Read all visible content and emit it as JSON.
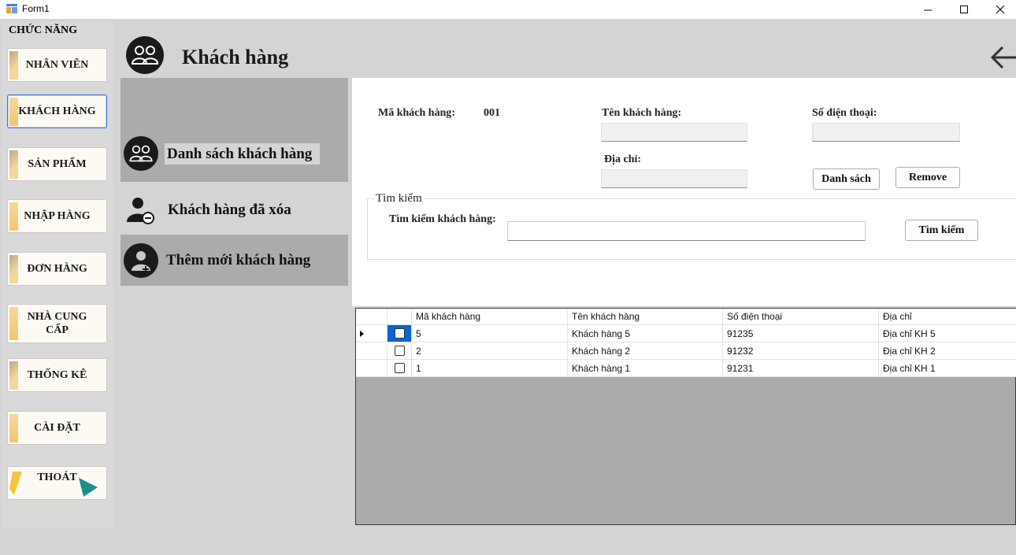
{
  "window": {
    "title": "Form1",
    "minimize_glyph": "—",
    "maximize_glyph": "☐",
    "close_glyph": "✕"
  },
  "sidebar": {
    "title": "CHỨC NĂNG",
    "items": [
      {
        "label": "NHÂN VIÊN"
      },
      {
        "label": "KHÁCH HÀNG"
      },
      {
        "label": "SẢN PHẨM"
      },
      {
        "label": "NHẬP HÀNG"
      },
      {
        "label": "ĐƠN HÀNG"
      },
      {
        "label": "NHÀ CUNG CẤP"
      },
      {
        "label": "THỐNG KÊ"
      },
      {
        "label": "CÀI ĐẶT"
      },
      {
        "label": "THOÁT"
      }
    ]
  },
  "header": {
    "title": "Khách hàng",
    "icon": "users-icon",
    "back_icon": "arrow-left-icon"
  },
  "submenu": {
    "items": [
      {
        "label": "Danh sách khách hàng",
        "icon": "users-icon"
      },
      {
        "label": "Khách hàng đã xóa",
        "icon": "user-minus-icon"
      },
      {
        "label": "Thêm mới khách hàng",
        "icon": "user-add-icon"
      }
    ]
  },
  "form": {
    "ma_label": "Mã khách hàng:",
    "ma_value": "001",
    "ten_label": "Tên khách hàng:",
    "sdt_label": "Số điện thoại:",
    "diachi_label": "Địa chỉ:",
    "danhsach_button": "Danh sách",
    "remove_button": "Remove",
    "search_group_title": "Tìm kiếm",
    "search_label": "Tìm kiếm khách hàng:",
    "search_button": "Tìm kiếm",
    "ten_value": "",
    "sdt_value": "",
    "diachi_value": "",
    "search_value": ""
  },
  "grid": {
    "columns": [
      "Mã khách hàng",
      "Tên khách hàng",
      "Số điện thoại",
      "Địa chỉ"
    ],
    "rows": [
      {
        "ma": "5",
        "ten": "Khách hàng 5",
        "sdt": "91235",
        "diachi": "Địa chỉ KH 5"
      },
      {
        "ma": "2",
        "ten": "Khách hàng 2",
        "sdt": "91232",
        "diachi": "Địa chỉ KH 2"
      },
      {
        "ma": "1",
        "ten": "Khách hàng 1",
        "sdt": "91231",
        "diachi": "Địa chỉ KH 1"
      }
    ]
  },
  "colors": {
    "accent": "#3b78d1",
    "sidebar_button_bg": "#fdfaf3",
    "submenu_active_bg": "#ababab",
    "grid_bg": "#ababab"
  }
}
